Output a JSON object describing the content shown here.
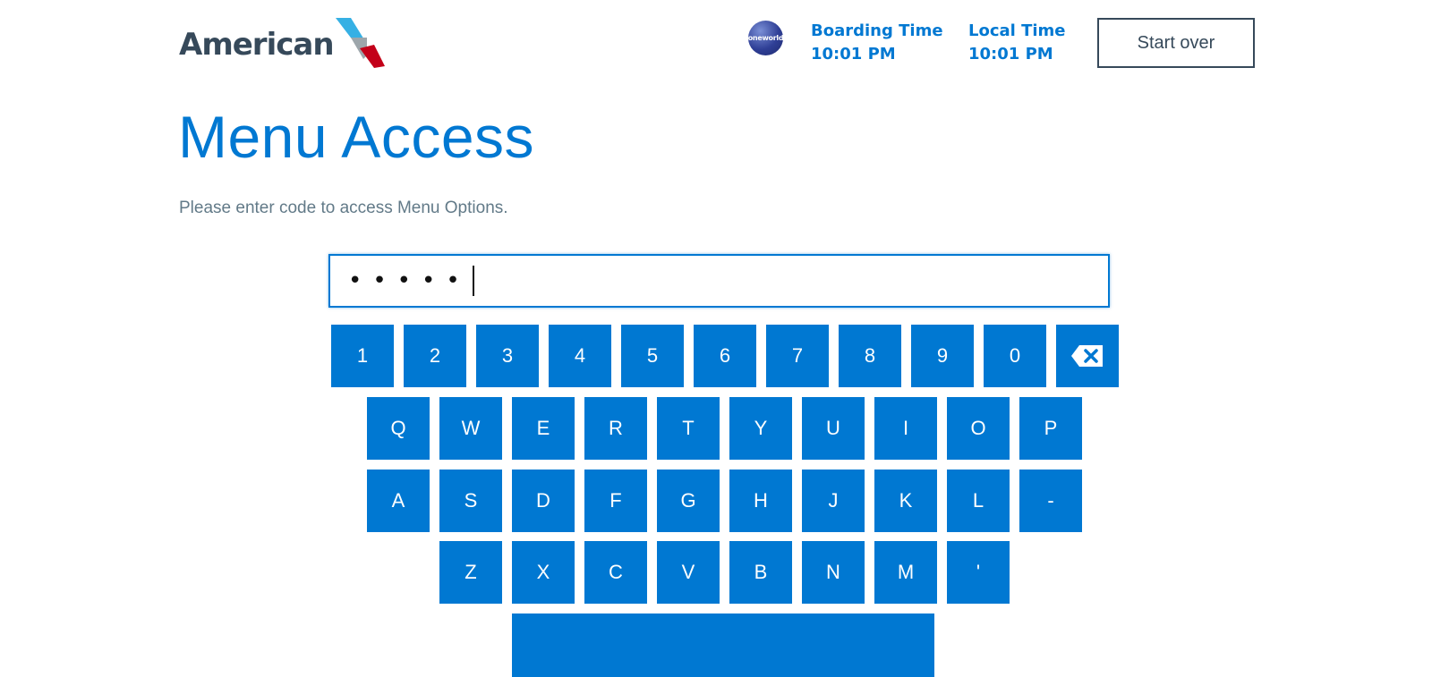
{
  "header": {
    "brand": "American",
    "alliance_badge": "oneworld",
    "boarding_time_label": "Boarding Time",
    "boarding_time_value": "10:01 PM",
    "local_time_label": "Local Time",
    "local_time_value": "10:01 PM",
    "start_over_label": "Start over"
  },
  "main": {
    "title": "Menu Access",
    "instruction": "Please enter code to access Menu Options.",
    "code_input": {
      "masked_value": "•••••"
    }
  },
  "keyboard": {
    "row1": [
      "1",
      "2",
      "3",
      "4",
      "5",
      "6",
      "7",
      "8",
      "9",
      "0"
    ],
    "backspace_icon": "backspace-icon",
    "row2": [
      "Q",
      "W",
      "E",
      "R",
      "T",
      "Y",
      "U",
      "I",
      "O",
      "P"
    ],
    "row3": [
      "A",
      "S",
      "D",
      "F",
      "G",
      "H",
      "J",
      "K",
      "L",
      "-"
    ],
    "row4": [
      "Z",
      "X",
      "C",
      "V",
      "B",
      "N",
      "M",
      "'"
    ],
    "space_label": ""
  },
  "colors": {
    "accent": "#0078D2",
    "dark": "#36495A",
    "muted": "#627A88",
    "logo_red": "#C30019",
    "logo_light_blue": "#36B0E4"
  }
}
